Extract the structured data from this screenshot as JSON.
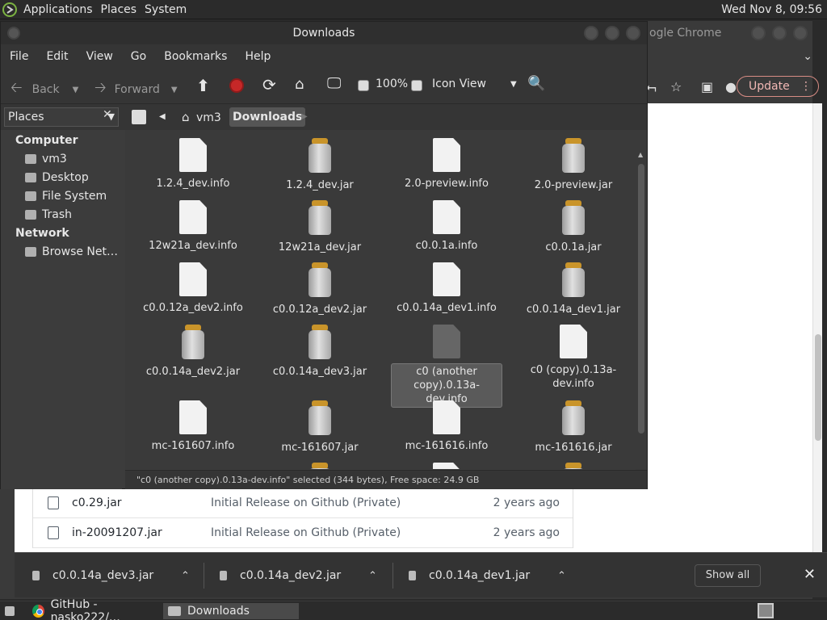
{
  "top_panel": {
    "menus": [
      "Applications",
      "Places",
      "System"
    ],
    "clock": "Wed Nov 8, 09:56"
  },
  "chrome": {
    "title": "ogle Chrome",
    "update_label": "Update",
    "files": [
      {
        "name": "c0.29.jar",
        "message": "Initial Release on Github (Private)",
        "age": "2 years ago"
      },
      {
        "name": "in-20091207.jar",
        "message": "Initial Release on Github (Private)",
        "age": "2 years ago"
      }
    ],
    "downloads": [
      "c0.0.14a_dev3.jar",
      "c0.0.14a_dev2.jar",
      "c0.0.14a_dev1.jar"
    ],
    "show_all": "Show all"
  },
  "file_manager": {
    "title": "Downloads",
    "menus": [
      "File",
      "Edit",
      "View",
      "Go",
      "Bookmarks",
      "Help"
    ],
    "toolbar": {
      "back": "Back",
      "forward": "Forward",
      "zoom": "100%",
      "view": "Icon View"
    },
    "sidebar": {
      "header": "Places",
      "sections": [
        {
          "title": "Computer",
          "items": [
            "vm3",
            "Desktop",
            "File System",
            "Trash"
          ]
        },
        {
          "title": "Network",
          "items": [
            "Browse Net…"
          ]
        }
      ]
    },
    "breadcrumbs": [
      "vm3",
      "Downloads"
    ],
    "files": [
      {
        "name": "1.2.4_dev.info",
        "type": "doc"
      },
      {
        "name": "1.2.4_dev.jar",
        "type": "jar"
      },
      {
        "name": "2.0-preview.info",
        "type": "doc"
      },
      {
        "name": "2.0-preview.jar",
        "type": "jar"
      },
      {
        "name": "12w21a_dev.info",
        "type": "doc"
      },
      {
        "name": "12w21a_dev.jar",
        "type": "jar"
      },
      {
        "name": "c0.0.1a.info",
        "type": "doc"
      },
      {
        "name": "c0.0.1a.jar",
        "type": "jar"
      },
      {
        "name": "c0.0.12a_dev2.info",
        "type": "doc"
      },
      {
        "name": "c0.0.12a_dev2.jar",
        "type": "jar"
      },
      {
        "name": "c0.0.14a_dev1.info",
        "type": "doc"
      },
      {
        "name": "c0.0.14a_dev1.jar",
        "type": "jar"
      },
      {
        "name": "c0.0.14a_dev2.jar",
        "type": "jar"
      },
      {
        "name": "c0.0.14a_dev3.jar",
        "type": "jar"
      },
      {
        "name": "c0 (another copy).0.13a-dev.info",
        "type": "doc",
        "selected": true
      },
      {
        "name": "c0 (copy).0.13a-dev.info",
        "type": "doc"
      },
      {
        "name": "mc-161607.info",
        "type": "doc"
      },
      {
        "name": "mc-161607.jar",
        "type": "jar"
      },
      {
        "name": "mc-161616.info",
        "type": "doc"
      },
      {
        "name": "mc-161616.jar",
        "type": "jar"
      }
    ],
    "status": "\"c0 (another copy).0.13a-dev.info\" selected (344 bytes), Free space: 24.9 GB"
  },
  "taskbar": {
    "tasks": [
      "GitHub - nasko222/…",
      "Downloads"
    ]
  }
}
